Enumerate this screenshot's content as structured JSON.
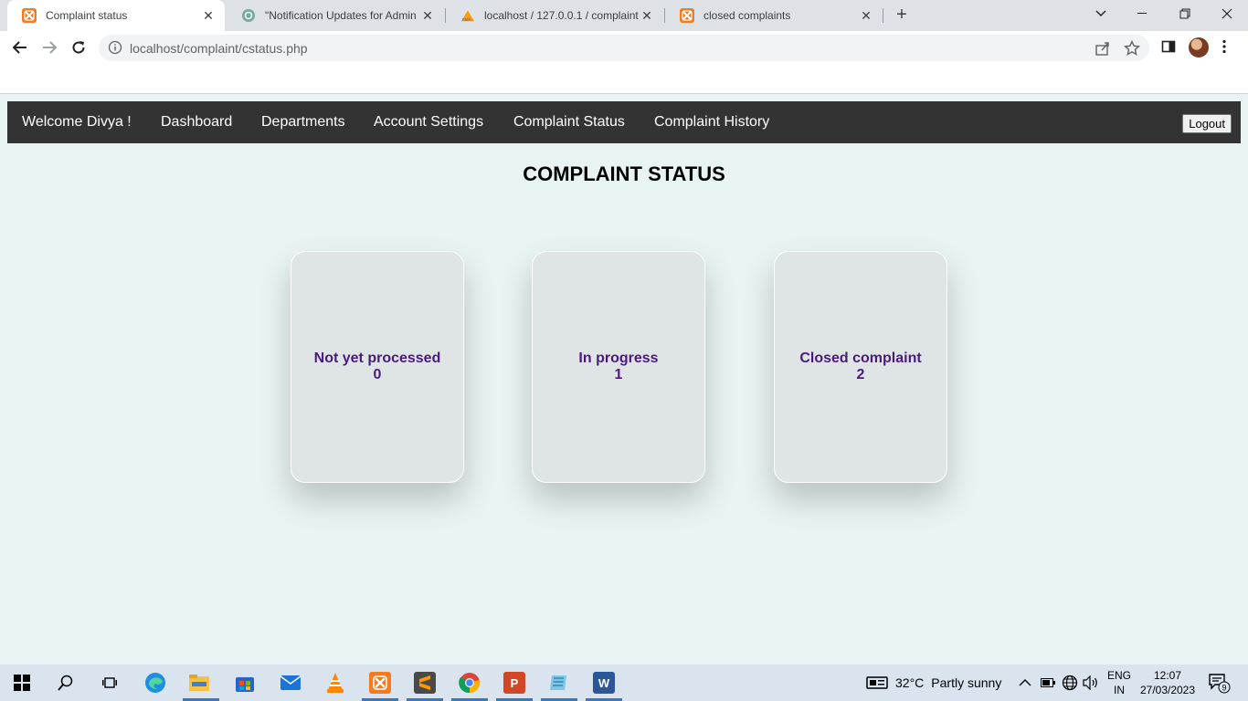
{
  "browser": {
    "tabs": [
      {
        "title": "Complaint status",
        "active": true
      },
      {
        "title": "\"Notification Updates for Admin",
        "active": false
      },
      {
        "title": "localhost / 127.0.0.1 / complaint",
        "active": false
      },
      {
        "title": "closed complaints",
        "active": false
      }
    ],
    "url": "localhost/complaint/cstatus.php"
  },
  "nav": {
    "welcome": "Welcome Divya !",
    "links": [
      "Dashboard",
      "Departments",
      "Account Settings",
      "Complaint Status",
      "Complaint History"
    ],
    "logout": "Logout"
  },
  "page": {
    "heading": "COMPLAINT STATUS",
    "cards": [
      {
        "label": "Not yet processed",
        "count": "0"
      },
      {
        "label": "In progress",
        "count": "1"
      },
      {
        "label": "Closed complaint",
        "count": "2"
      }
    ]
  },
  "taskbar": {
    "weather_temp": "32°C",
    "weather_desc": "Partly sunny",
    "lang_line1": "ENG",
    "lang_line2": "IN",
    "time": "12:07",
    "date": "27/03/2023",
    "notifications": "9"
  },
  "colors": {
    "nav_bg": "#333333",
    "page_bg": "#e8f3f3",
    "card_text": "#4b1a7f",
    "card_bg": "#dfe4e4"
  }
}
